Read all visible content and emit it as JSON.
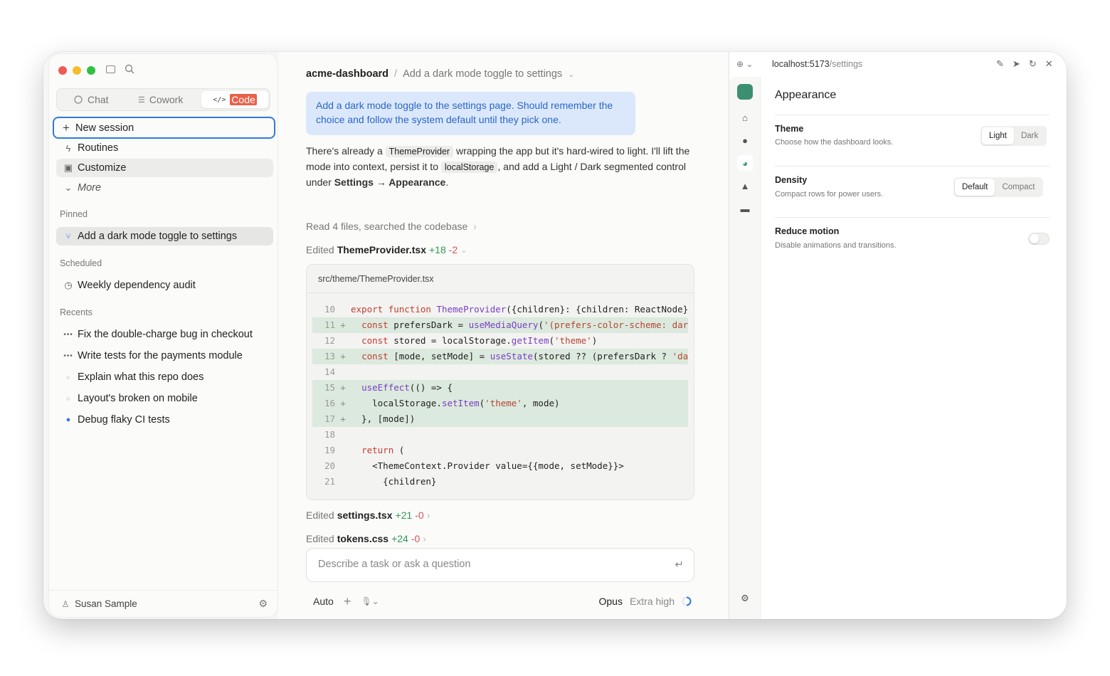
{
  "sidebar": {
    "tabs": [
      {
        "label": "Chat",
        "icon": "chat-icon"
      },
      {
        "label": "Cowork",
        "icon": "list-icon"
      },
      {
        "label": "Code",
        "icon": "code-icon"
      }
    ],
    "active_tab": "Code",
    "actions": [
      {
        "label": "New session",
        "icon": "plus-icon"
      },
      {
        "label": "Routines",
        "icon": "bolt-icon"
      },
      {
        "label": "Customize",
        "icon": "box-icon"
      },
      {
        "label": "More",
        "icon": "chevron-down-icon"
      }
    ],
    "pinned_header": "Pinned",
    "pinned": [
      {
        "label": "Add a dark mode toggle to settings"
      }
    ],
    "scheduled_header": "Scheduled",
    "scheduled": [
      {
        "label": "Weekly dependency audit"
      }
    ],
    "recents_header": "Recents",
    "recents": [
      {
        "label": "Fix the double-charge bug in checkout",
        "status": "running"
      },
      {
        "label": "Write tests for the payments module",
        "status": "running"
      },
      {
        "label": "Explain what this repo does",
        "status": "idle"
      },
      {
        "label": "Layout's broken on mobile",
        "status": "idle"
      },
      {
        "label": "Debug flaky CI tests",
        "status": "active"
      }
    ],
    "user": "Susan Sample"
  },
  "main": {
    "repo": "acme-dashboard",
    "separator": "/",
    "session_title": "Add a dark mode toggle to settings",
    "user_message": "Add a dark mode toggle to the settings page. Should remember the choice and follow the system default until they pick one.",
    "reply": {
      "p1": "There's already a ",
      "chip1": "ThemeProvider",
      "p2": " wrapping the app but it's hard-wired to light. I'll lift the mode into context, persist it to ",
      "chip2": "localStorage",
      "p3": ", and add a Light / Dark segmented control under ",
      "bold": "Settings → Appearance",
      "p4": "."
    },
    "read_summary": "Read 4 files, searched the codebase",
    "edits": [
      {
        "prefix": "Edited",
        "file": "ThemeProvider.tsx",
        "added": "+18",
        "removed": "-2"
      },
      {
        "prefix": "Edited",
        "file": "settings.tsx",
        "added": "+21",
        "removed": "-0"
      },
      {
        "prefix": "Edited",
        "file": "tokens.css",
        "added": "+24",
        "removed": "-0"
      }
    ],
    "code_path": "src/theme/ThemeProvider.tsx",
    "code_lines": [
      {
        "n": "10",
        "mark": "",
        "added": false,
        "text": "export function ThemeProvider({children}: {children: ReactNode}) {"
      },
      {
        "n": "11",
        "mark": "+",
        "added": true,
        "text": "  const prefersDark = useMediaQuery('(prefers-color-scheme: dark)')"
      },
      {
        "n": "12",
        "mark": "",
        "added": false,
        "text": "  const stored = localStorage.getItem('theme')"
      },
      {
        "n": "13",
        "mark": "+",
        "added": true,
        "text": "  const [mode, setMode] = useState(stored ?? (prefersDark ? 'dark' : 'light'))"
      },
      {
        "n": "14",
        "mark": "",
        "added": false,
        "text": ""
      },
      {
        "n": "15",
        "mark": "+",
        "added": true,
        "text": "  useEffect(() => {"
      },
      {
        "n": "16",
        "mark": "+",
        "added": true,
        "text": "    localStorage.setItem('theme', mode)"
      },
      {
        "n": "17",
        "mark": "+",
        "added": true,
        "text": "  }, [mode])"
      },
      {
        "n": "18",
        "mark": "",
        "added": false,
        "text": ""
      },
      {
        "n": "19",
        "mark": "",
        "added": false,
        "text": "  return ("
      },
      {
        "n": "20",
        "mark": "",
        "added": false,
        "text": "    <ThemeContext.Provider value={{mode, setMode}}>"
      },
      {
        "n": "21",
        "mark": "",
        "added": false,
        "text": "      {children}"
      }
    ],
    "input_placeholder": "Describe a task or ask a question",
    "mode": "Auto",
    "model": "Opus",
    "effort": "Extra high"
  },
  "preview": {
    "url_host": "localhost:5173",
    "url_path": "/settings",
    "page_title": "Appearance",
    "settings": [
      {
        "label": "Theme",
        "desc": "Choose how the dashboard looks.",
        "options": [
          "Light",
          "Dark"
        ],
        "selected": "Light"
      },
      {
        "label": "Density",
        "desc": "Compact rows for power users.",
        "options": [
          "Default",
          "Compact"
        ],
        "selected": "Default"
      },
      {
        "label": "Reduce motion",
        "desc": "Disable animations and transitions.",
        "toggle": false
      }
    ],
    "accent_color": "#3d8f72"
  },
  "colors": {
    "close": "#ee5b53",
    "minimize": "#f5bd2e",
    "maximize": "#30c142",
    "link_blue": "#2e7bd6",
    "code_orange": "#e8624a"
  }
}
